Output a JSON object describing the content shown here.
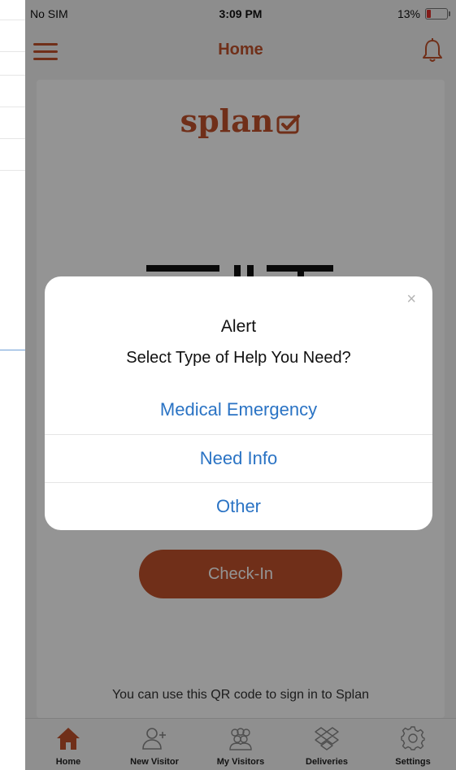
{
  "status_bar": {
    "carrier": "No SIM",
    "time": "3:09 PM",
    "battery": "13%"
  },
  "nav": {
    "title": "Home",
    "menu_icon": "hamburger-menu-icon",
    "bell_icon": "bell-icon"
  },
  "home": {
    "logo_text": "splan",
    "checkin_label": "Check-In",
    "hint": "You can use this QR code to sign in to Splan"
  },
  "alert": {
    "close_glyph": "×",
    "title": "Alert",
    "message": "Select Type of Help You Need?",
    "options": [
      "Medical Emergency",
      "Need Info",
      "Other"
    ]
  },
  "tabs": [
    {
      "label": "Home",
      "icon": "home-icon",
      "active": true
    },
    {
      "label": "New Visitor",
      "icon": "add-user-icon",
      "active": false
    },
    {
      "label": "My Visitors",
      "icon": "group-icon",
      "active": false
    },
    {
      "label": "Deliveries",
      "icon": "dropbox-icon",
      "active": false
    },
    {
      "label": "Settings",
      "icon": "gear-icon",
      "active": false
    }
  ],
  "colors": {
    "brand": "#c2522b",
    "link": "#2a73c4",
    "overlay": "rgba(0,0,0,0.42)"
  }
}
